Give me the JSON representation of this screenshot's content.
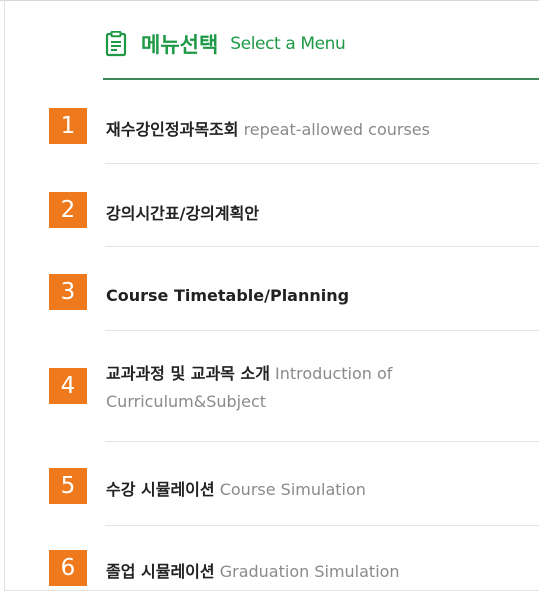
{
  "header": {
    "icon": "clipboard-list-icon",
    "title": "메뉴선택",
    "subtitle": "Select a Menu",
    "accent_color": "#1e9a46"
  },
  "badge_color": "#ef7a1e",
  "menu": {
    "items": [
      {
        "number": "1",
        "label_ko": "재수강인정과목조회",
        "label_en": "repeat-allowed courses"
      },
      {
        "number": "2",
        "label_ko": "강의시간표/강의계획안",
        "label_en": ""
      },
      {
        "number": "3",
        "label_ko": "",
        "label_en": "Course Timetable/Planning"
      },
      {
        "number": "4",
        "label_ko": "교과과정 및 교과목 소개",
        "label_en": "Introduction of Curriculum&Subject"
      },
      {
        "number": "5",
        "label_ko": "수강 시뮬레이션",
        "label_en": "Course Simulation"
      },
      {
        "number": "6",
        "label_ko": "졸업 시뮬레이션",
        "label_en": "Graduation Simulation"
      }
    ]
  }
}
